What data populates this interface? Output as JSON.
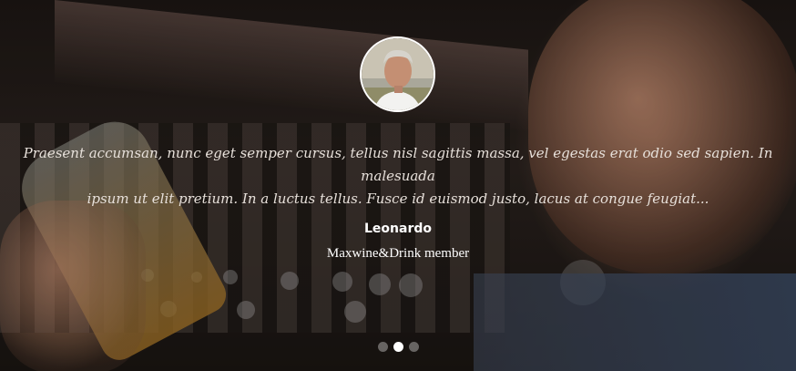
{
  "testimonial": {
    "quote_line1": "Praesent accumsan, nunc eget semper cursus, tellus nisl sagittis massa, vel egestas erat odio sed sapien. In malesuada",
    "quote_line2": "ipsum ut elit pretium. In a luctus tellus. Fusce id euismod justo, lacus at congue feugiat...",
    "author_name": "Leonardo",
    "author_role": "Maxwine&Drink member",
    "avatar_icon": "person-avatar"
  },
  "carousel": {
    "slide_count": 3,
    "active_index": 1
  },
  "colors": {
    "quote_text": "#e7e0da",
    "name_text": "#ffffff",
    "dot_active": "#ffffff",
    "dot_inactive": "rgba(255,255,255,0.35)"
  }
}
